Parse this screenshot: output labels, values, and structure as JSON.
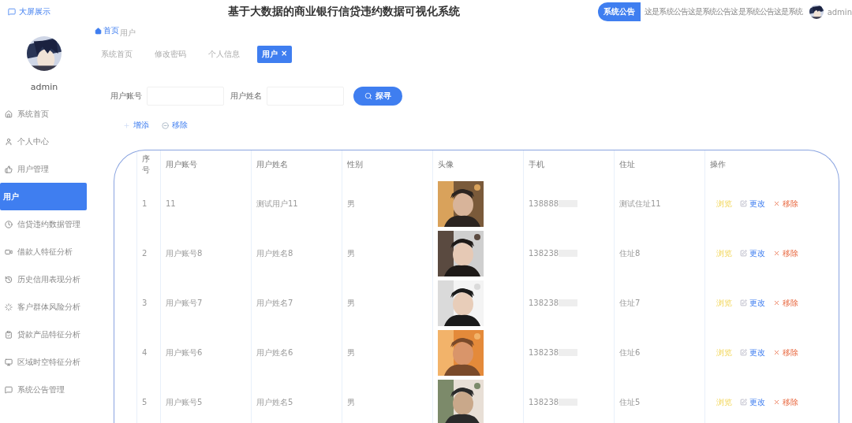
{
  "header": {
    "screen_link": "大屏展示",
    "title": "基于大数据的商业银行信贷违约数据可视化系统",
    "notice": {
      "label": "系统公告",
      "text": "这是系统公告这是系统公告这是系统公告这是系统"
    },
    "user": "admin"
  },
  "sidebar": {
    "user": "admin",
    "items": [
      {
        "label": "系统首页",
        "selected": false
      },
      {
        "label": "个人中心",
        "selected": false
      },
      {
        "label": "用户管理",
        "selected": false,
        "children": [
          {
            "label": "用户",
            "selected": true
          }
        ]
      },
      {
        "label": "信贷违约数据管理",
        "selected": false
      },
      {
        "label": "借款人特征分析",
        "selected": false
      },
      {
        "label": "历史信用表现分析",
        "selected": false
      },
      {
        "label": "客户群体风险分析",
        "selected": false
      },
      {
        "label": "贷款产品特征分析",
        "selected": false
      },
      {
        "label": "区域时空特征分析",
        "selected": false
      },
      {
        "label": "系统公告管理",
        "selected": false
      }
    ]
  },
  "breadcrumb": [
    "首页",
    "用户"
  ],
  "tags": [
    {
      "label": "系统首页",
      "selected": false
    },
    {
      "label": "修改密码",
      "selected": false
    },
    {
      "label": "个人信息",
      "selected": false
    },
    {
      "label": "用户",
      "selected": true,
      "close": "×"
    }
  ],
  "search": {
    "fields": [
      {
        "label": "用户账号"
      },
      {
        "label": "用户姓名"
      }
    ],
    "button": "探寻"
  },
  "toolbar": [
    {
      "kind": "add",
      "label": "增添"
    },
    {
      "kind": "remove",
      "label": "移除"
    }
  ],
  "table": {
    "columns": [
      "序号",
      "用户账号",
      "用户姓名",
      "性别",
      "头像",
      "手机",
      "住址",
      "操作"
    ],
    "rows": [
      {
        "index": "1",
        "account": "11",
        "name": "测试用户11",
        "gender": "男",
        "phone": "138888",
        "address": "测试住址11",
        "actions": [
          {
            "kind": "view",
            "label": "浏览"
          },
          {
            "kind": "edit",
            "label": "更改"
          },
          {
            "kind": "delete",
            "label": "移除"
          }
        ]
      },
      {
        "index": "2",
        "account": "用户账号8",
        "name": "用户姓名8",
        "gender": "男",
        "phone": "138238",
        "address": "住址8",
        "actions": [
          {
            "kind": "view",
            "label": "浏览"
          },
          {
            "kind": "edit",
            "label": "更改"
          },
          {
            "kind": "delete",
            "label": "移除"
          }
        ]
      },
      {
        "index": "3",
        "account": "用户账号7",
        "name": "用户姓名7",
        "gender": "男",
        "phone": "138238",
        "address": "住址7",
        "actions": [
          {
            "kind": "view",
            "label": "浏览"
          },
          {
            "kind": "edit",
            "label": "更改"
          },
          {
            "kind": "delete",
            "label": "移除"
          }
        ]
      },
      {
        "index": "4",
        "account": "用户账号6",
        "name": "用户姓名6",
        "gender": "男",
        "phone": "138238",
        "address": "住址6",
        "actions": [
          {
            "kind": "view",
            "label": "浏览"
          },
          {
            "kind": "edit",
            "label": "更改"
          },
          {
            "kind": "delete",
            "label": "移除"
          }
        ]
      },
      {
        "index": "5",
        "account": "用户账号5",
        "name": "用户姓名5",
        "gender": "男",
        "phone": "138238",
        "address": "住址5",
        "actions": [
          {
            "kind": "view",
            "label": "浏览"
          },
          {
            "kind": "edit",
            "label": "更改"
          },
          {
            "kind": "delete",
            "label": "移除"
          }
        ]
      }
    ]
  }
}
